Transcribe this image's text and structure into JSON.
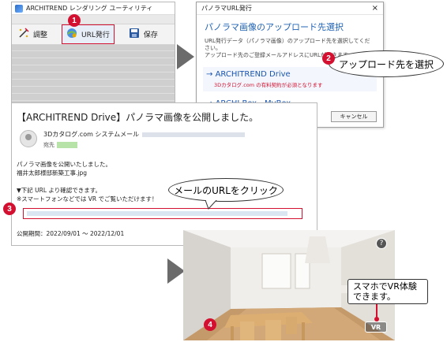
{
  "app": {
    "title": "ARCHITREND レンダリング ユーティリティ",
    "toolbar": [
      {
        "label": "調整",
        "icon": "adjust-icon"
      },
      {
        "label": "URL発行",
        "icon": "url-publish-icon"
      },
      {
        "label": "保存",
        "icon": "save-icon"
      }
    ]
  },
  "dialog": {
    "title": "パノラマURL発行",
    "heading": "パノラマ画像のアップロード先選択",
    "desc_lines": [
      "URL発行データ（パノラマ画像）のアップロード先を選択してください。",
      "アップロード先のご登録メールアドレスにURLが届きます。"
    ],
    "options": [
      {
        "label": "ARCHITREND Drive",
        "sublabel": "3Dカタログ.com の有料契約が必須となります"
      },
      {
        "label": "ARCHI Box - MyBox",
        "sublabel": ""
      }
    ],
    "cancel_label": "キャンセル",
    "close_glyph": "×"
  },
  "mail": {
    "subject": "【ARCHITREND Drive】パノラマ画像を公開しました。",
    "sender": "3Dカタログ.com システムメール",
    "to_label": "宛先",
    "body_lines": [
      "パノラマ画像を公開いたしました。",
      "福井太郎様邸新築工事.jpg",
      "",
      "▼下記 URL より確認できます。",
      "※スマートフォンなどでは VR でご覧いただけます！"
    ],
    "period": "公開期間：2022/09/01 〜 2022/12/01"
  },
  "vr": {
    "help_glyph": "?",
    "vr_button_label": "VR"
  },
  "steps": {
    "s1": "1",
    "s2": "2",
    "s3": "3",
    "s4": "4"
  },
  "callouts": {
    "c2": "アップロード先を選択",
    "c3": "メールのURLをクリック",
    "c4_line1": "スマホでVR体験",
    "c4_line2": "できます。"
  },
  "colors": {
    "accent_red": "#d3102f",
    "link_blue": "#1a55b0"
  }
}
